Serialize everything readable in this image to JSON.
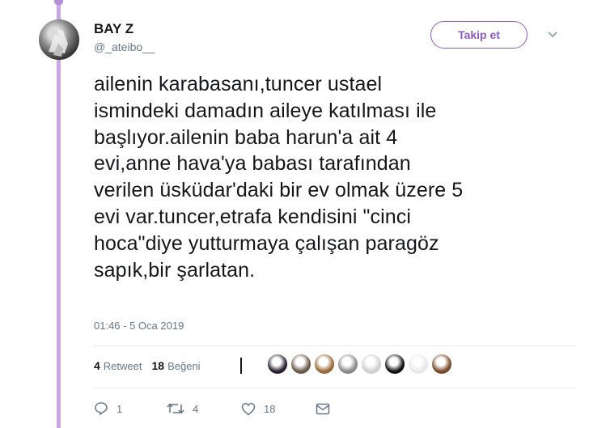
{
  "user": {
    "name": "BAY Z",
    "handle": "@_ateibo__"
  },
  "follow_button": {
    "label": "Takip et"
  },
  "tweet": {
    "lines": [
      "ailenin karabasanı,tuncer ustael",
      "ismindeki damadın aileye katılması ile",
      "başlıyor.ailenin baba harun'a ait 4",
      "evi,anne hava'ya babası tarafından",
      "verilen üsküdar'daki bir ev olmak üzere 5",
      "evi var.tuncer,etrafa kendisini \"cinci",
      "hoca\"diye yutturmaya çalışan paragöz",
      "sapık,bir şarlatan."
    ],
    "timestamp": "01:46 - 5 Oca 2019"
  },
  "stats": {
    "retweets_count": "4",
    "retweets_label": "Retweet",
    "likes_count": "18",
    "likes_label": "Beğeni"
  },
  "likers": [
    {
      "icon": "liker-avatar",
      "color": "#2a2030"
    },
    {
      "icon": "liker-avatar",
      "color": "#6b5a4a"
    },
    {
      "icon": "liker-avatar",
      "color": "#9a6a3a"
    },
    {
      "icon": "liker-avatar",
      "color": "#8a8a8a"
    },
    {
      "icon": "liker-avatar",
      "color": "#cfcfcf"
    },
    {
      "icon": "liker-avatar",
      "color": "#111111"
    },
    {
      "icon": "liker-avatar",
      "color": "#e8e8e8"
    },
    {
      "icon": "liker-avatar",
      "color": "#7a4a2a"
    }
  ],
  "actions": {
    "reply_count": "1",
    "retweet_count": "4",
    "like_count": "18"
  },
  "colors": {
    "accent": "#8f5bc0",
    "rail": "#c9a6e6",
    "secondary_text": "#657786"
  }
}
